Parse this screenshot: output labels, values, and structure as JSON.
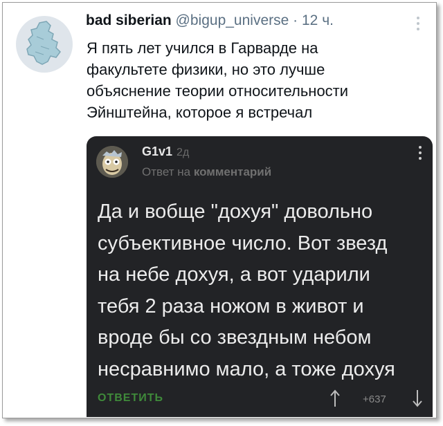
{
  "tweet": {
    "display_name": "bad siberian",
    "handle": "@bigup_universe",
    "separator": "·",
    "time": "12 ч.",
    "text_lines": [
      "Я пять лет учился в Гарварде на",
      "факультете физики, но это лучше",
      "объяснение теории относительности",
      "Эйнштейна, которое я встречал"
    ],
    "more_icon": "vertical-ellipsis-icon"
  },
  "comment": {
    "username": "G1v1",
    "age": "2д",
    "reply_prefix": "Ответ на",
    "reply_target": "комментарий",
    "body_lines": [
      "Да и вобще \"дохуя\" довольно",
      "субъективное число. Вот звезд",
      "на небе дохуя, а вот ударили",
      "тебя 2 раза ножом в живот и",
      "вроде бы со звездным небом",
      "несравнимо мало, а тоже дохуя"
    ],
    "reply_label": "ОТВЕТИТЬ",
    "score": "+637",
    "icons": {
      "upvote": "arrow-up-icon",
      "downvote": "arrow-down-icon",
      "more": "vertical-ellipsis-icon"
    }
  },
  "colors": {
    "dark_card": "#222326",
    "reply_green": "#3f8a3a",
    "muted_gray": "#5b7083"
  }
}
